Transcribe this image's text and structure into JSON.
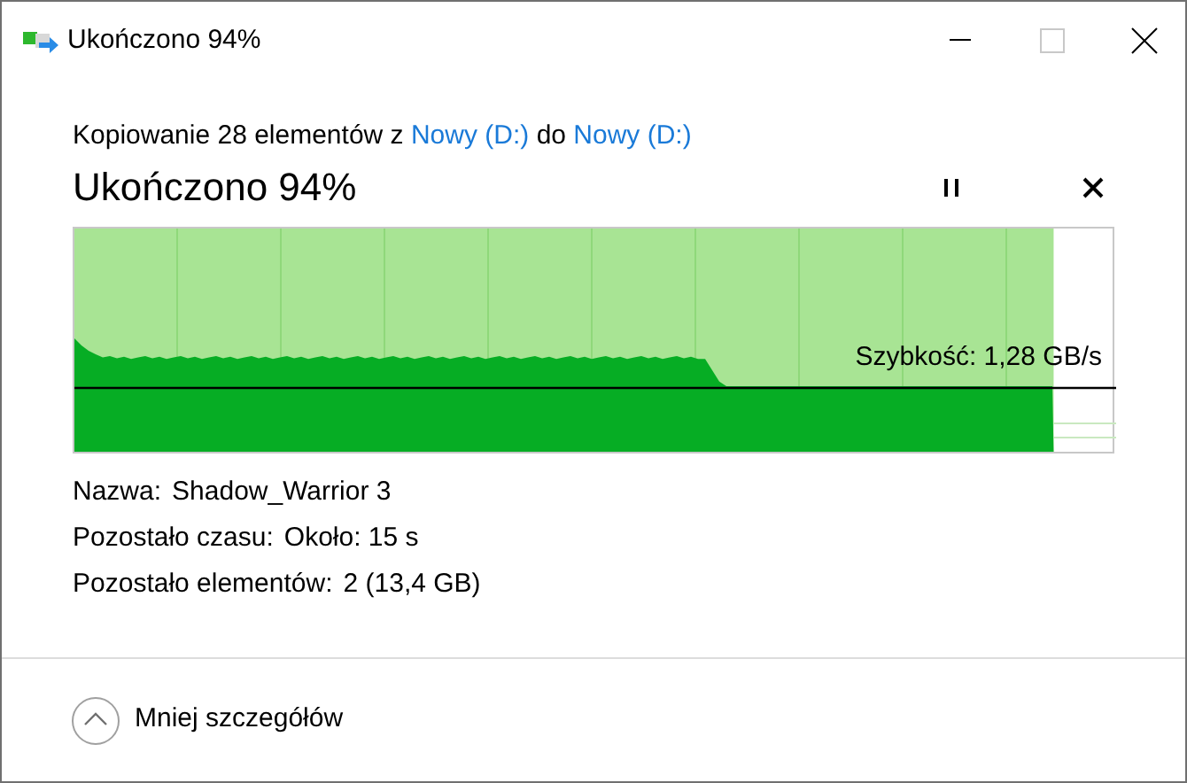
{
  "window": {
    "title": "Ukończono 94%"
  },
  "copy_line": {
    "prefix": "Kopiowanie 28 elementów z",
    "source": "Nowy (D:)",
    "middle": "do",
    "destination": "Nowy (D:)"
  },
  "heading": "Ukończono 94%",
  "progress": {
    "level": 0.94,
    "speed": "Szybkość: 1,28 GB/s"
  },
  "details": [
    {
      "label": "Nazwa:",
      "value": "Shadow_Warrior 3"
    },
    {
      "label": "Pozostało czasu:",
      "value": "Około: 15 s"
    },
    {
      "label": "Pozostało elementów:",
      "value": "2 (13,4 GB)"
    }
  ],
  "footer": {
    "toggle": "Mniej szczegółów",
    "expanded": true
  }
}
